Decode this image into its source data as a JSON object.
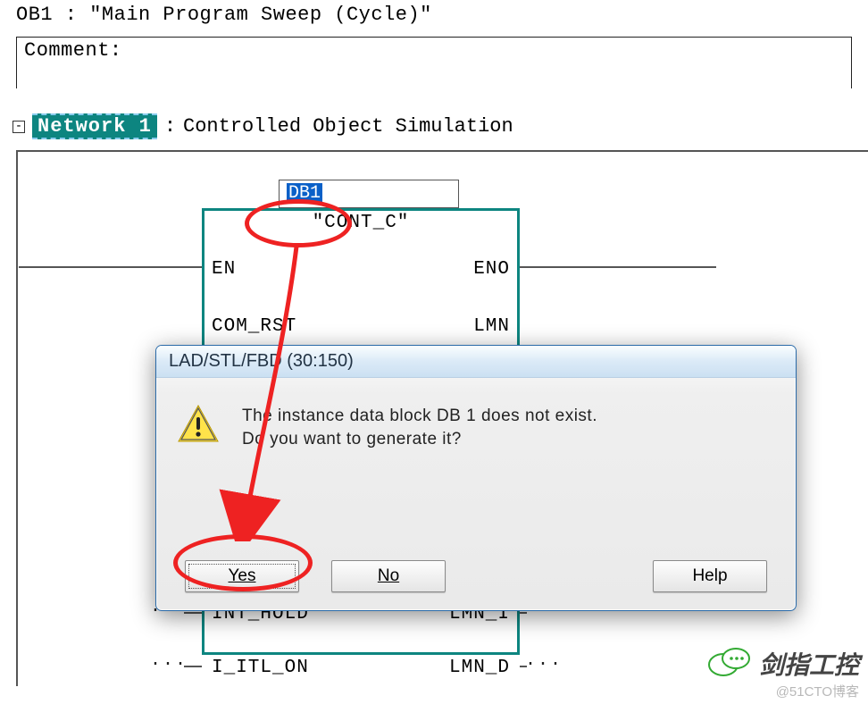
{
  "header": {
    "block": "OB1",
    "sep": " :  ",
    "title_quoted": "\"Main Program Sweep (Cycle)\""
  },
  "comment": {
    "label": "Comment:"
  },
  "network": {
    "toggle": "-",
    "badge": "Network 1",
    "sep": ":",
    "title": "Controlled Object Simulation"
  },
  "block_call": {
    "db_input": "DB1",
    "fb_name": "\"CONT_C\"",
    "ports": {
      "row1_left": "EN",
      "row1_right": "ENO",
      "row2_left": "COM_RST",
      "row2_right": "LMN",
      "row3_left": "INT_HOLD",
      "row3_right": "LMN_I",
      "row4_left": "I_ITL_ON",
      "row4_right": "LMN_D"
    },
    "wire_dots": "..."
  },
  "dialog": {
    "title": "LAD/STL/FBD (30:150)",
    "message_line1": "The instance data block DB 1 does not exist.",
    "message_line2": "Do you want to generate it?",
    "buttons": {
      "yes": "Yes",
      "no": "No",
      "help": "Help"
    }
  },
  "watermark": {
    "text": "剑指工控",
    "credit": "@51CTO博客"
  }
}
